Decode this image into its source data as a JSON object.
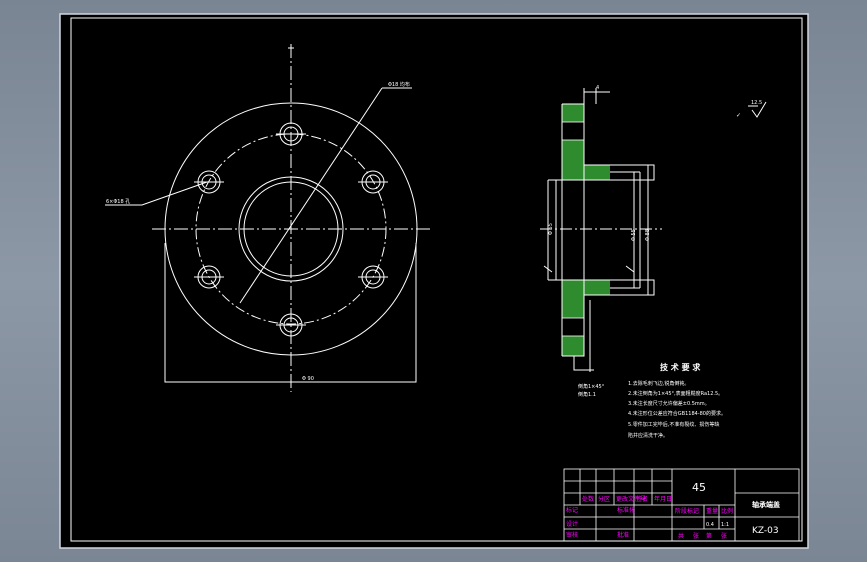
{
  "drawing": {
    "background": "#000000",
    "line_color": "#ffffff",
    "title_block_color": "#ff00ff",
    "hatch_color": "#2e8b2e",
    "window_bg": "#7f8a98"
  },
  "labels": {
    "bolt_circle": "Φ18 均布",
    "hole_callout": "6×Φ18 孔",
    "bottom_dim": "Φ 90",
    "top_dim": "4",
    "roughness_value": "12.5",
    "section_note_1": "倒角1×45°",
    "section_note_2": "倒角1.1",
    "side_dim_1": "Φ 88",
    "side_dim_2": "Φ 55"
  },
  "tech_requirements": {
    "title": "技 术 要 求",
    "items": [
      "1.去除毛刺飞边,锐角倒钝。",
      "2.未注倒角为1×45°,表面粗糙度Ra12.5。",
      "3.未注长度尺寸允许偏差±0.5mm。",
      "4.未注形位公差应符合GB1184-80的要求。",
      "5.零件加工完毕后,不准有裂纹、损伤等缺",
      "  陷并应清洗干净。"
    ]
  },
  "title_block": {
    "material": "45",
    "part_name": "轴承端盖",
    "drawing_no": "KZ-03",
    "scale": "1:1",
    "weight": "0.4",
    "row_labels": [
      "标记",
      "设计",
      "审核",
      "工艺"
    ],
    "header_cells": [
      "处数",
      "分区",
      "更改文件号",
      "签名",
      "年月日"
    ],
    "stage_labels": [
      "阶段标记",
      "重量",
      "比例"
    ],
    "sheet_labels": [
      "共",
      "张",
      "第",
      "张"
    ],
    "standardize": "标准化",
    "approve": "批准"
  }
}
